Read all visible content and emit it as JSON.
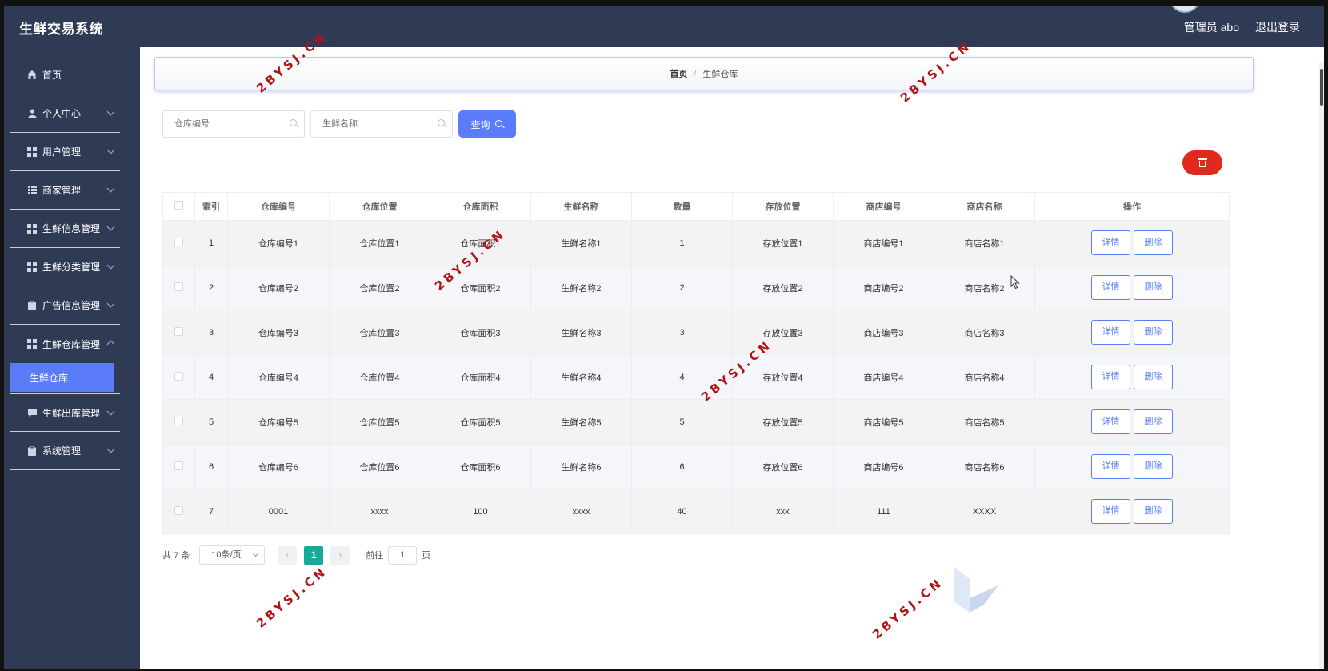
{
  "app": {
    "title": "生鲜交易系统"
  },
  "header": {
    "user_label": "管理员 abo",
    "logout_label": "退出登录"
  },
  "sidebar": {
    "items": [
      {
        "label": "首页",
        "icon": "home-icon"
      },
      {
        "label": "个人中心",
        "icon": "user-icon"
      },
      {
        "label": "用户管理",
        "icon": "grid-icon"
      },
      {
        "label": "商家管理",
        "icon": "apps-icon"
      },
      {
        "label": "生鲜信息管理",
        "icon": "grid-icon"
      },
      {
        "label": "生鲜分类管理",
        "icon": "grid-icon"
      },
      {
        "label": "广告信息管理",
        "icon": "clipboard-icon"
      },
      {
        "label": "生鲜仓库管理",
        "icon": "grid-icon"
      },
      {
        "label": "生鲜出库管理",
        "icon": "chat-icon"
      },
      {
        "label": "系统管理",
        "icon": "clipboard-icon"
      }
    ],
    "active_sub": "生鲜仓库"
  },
  "breadcrumb": {
    "home": "首页",
    "separator": "/",
    "current": "生鲜仓库"
  },
  "search": {
    "warehouse_no_placeholder": "仓库编号",
    "fresh_name_placeholder": "生鲜名称",
    "query_label": "查询"
  },
  "table": {
    "headers": [
      "索引",
      "仓库编号",
      "仓库位置",
      "仓库面积",
      "生鲜名称",
      "数量",
      "存放位置",
      "商店编号",
      "商店名称",
      "操作"
    ],
    "rows": [
      [
        "1",
        "仓库编号1",
        "仓库位置1",
        "仓库面积1",
        "生鲜名称1",
        "1",
        "存放位置1",
        "商店编号1",
        "商店名称1"
      ],
      [
        "2",
        "仓库编号2",
        "仓库位置2",
        "仓库面积2",
        "生鲜名称2",
        "2",
        "存放位置2",
        "商店编号2",
        "商店名称2"
      ],
      [
        "3",
        "仓库编号3",
        "仓库位置3",
        "仓库面积3",
        "生鲜名称3",
        "3",
        "存放位置3",
        "商店编号3",
        "商店名称3"
      ],
      [
        "4",
        "仓库编号4",
        "仓库位置4",
        "仓库面积4",
        "生鲜名称4",
        "4",
        "存放位置4",
        "商店编号4",
        "商店名称4"
      ],
      [
        "5",
        "仓库编号5",
        "仓库位置5",
        "仓库面积5",
        "生鲜名称5",
        "5",
        "存放位置5",
        "商店编号5",
        "商店名称5"
      ],
      [
        "6",
        "仓库编号6",
        "仓库位置6",
        "仓库面积6",
        "生鲜名称6",
        "6",
        "存放位置6",
        "商店编号6",
        "商店名称6"
      ],
      [
        "7",
        "0001",
        "xxxx",
        "100",
        "xxxx",
        "40",
        "xxx",
        "111",
        "XXXX"
      ]
    ],
    "detail_label": "详情",
    "delete_label": "删除"
  },
  "pagination": {
    "total_text": "共 7 条",
    "page_size": "10条/页",
    "current_page": "1",
    "goto_prefix": "前往",
    "goto_value": "1",
    "goto_suffix": "页"
  },
  "watermark": {
    "text": "2BYSJ.CN"
  },
  "colors": {
    "sidebar_bg": "#2f3a55",
    "primary": "#5b7cfa",
    "danger": "#e02a1d",
    "page_active": "#18a99a"
  }
}
